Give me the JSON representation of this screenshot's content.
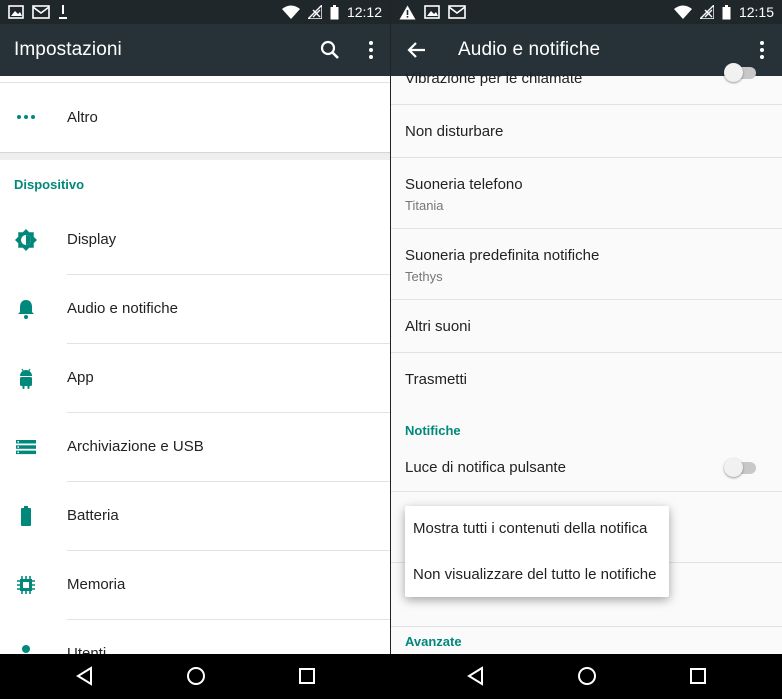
{
  "colors": {
    "toolbar": "#263238",
    "statusbar": "#1f272b",
    "accent": "#00897b"
  },
  "left": {
    "status": {
      "time": "12:12",
      "icons": [
        "image-icon",
        "mail-icon",
        "download-icon",
        "wifi-icon",
        "no-signal-icon",
        "battery-icon"
      ]
    },
    "toolbar": {
      "title": "Impostazioni",
      "actions": [
        "search-icon",
        "overflow-icon"
      ]
    },
    "items_top": [
      {
        "label": "Altro",
        "icon": "more-horiz-icon"
      }
    ],
    "section": "Dispositivo",
    "items": [
      {
        "label": "Display",
        "icon": "brightness-icon"
      },
      {
        "label": "Audio e notifiche",
        "icon": "bell-icon"
      },
      {
        "label": "App",
        "icon": "android-icon"
      },
      {
        "label": "Archiviazione e USB",
        "icon": "storage-icon"
      },
      {
        "label": "Batteria",
        "icon": "battery-icon"
      },
      {
        "label": "Memoria",
        "icon": "memory-icon"
      },
      {
        "label": "Utenti",
        "icon": "person-icon"
      }
    ]
  },
  "right": {
    "status": {
      "time": "12:15",
      "icons": [
        "warning-icon",
        "image-icon",
        "mail-icon",
        "wifi-icon",
        "no-signal-icon",
        "battery-icon"
      ]
    },
    "toolbar": {
      "title": "Audio e notifiche",
      "back": "back-arrow-icon",
      "actions": [
        "overflow-icon"
      ]
    },
    "rows": [
      {
        "primary": "Vibrazione per le chiamate",
        "toggle": false
      },
      {
        "primary": "Non disturbare"
      },
      {
        "primary": "Suoneria telefono",
        "secondary": "Titania"
      },
      {
        "primary": "Suoneria predefinita notifiche",
        "secondary": "Tethys"
      },
      {
        "primary": "Altri suoni"
      },
      {
        "primary": "Trasmetti"
      }
    ],
    "section_notifiche": "Notifiche",
    "notif_row": {
      "primary": "Luce di notifica pulsante",
      "toggle": false
    },
    "section_avanzate": "Avanzate",
    "popup": {
      "options": [
        "Mostra tutti i contenuti della notifica",
        "Non visualizzare del tutto le notifiche"
      ]
    }
  },
  "navbar": {
    "buttons": [
      "back-nav-icon",
      "home-nav-icon",
      "recents-nav-icon"
    ]
  }
}
